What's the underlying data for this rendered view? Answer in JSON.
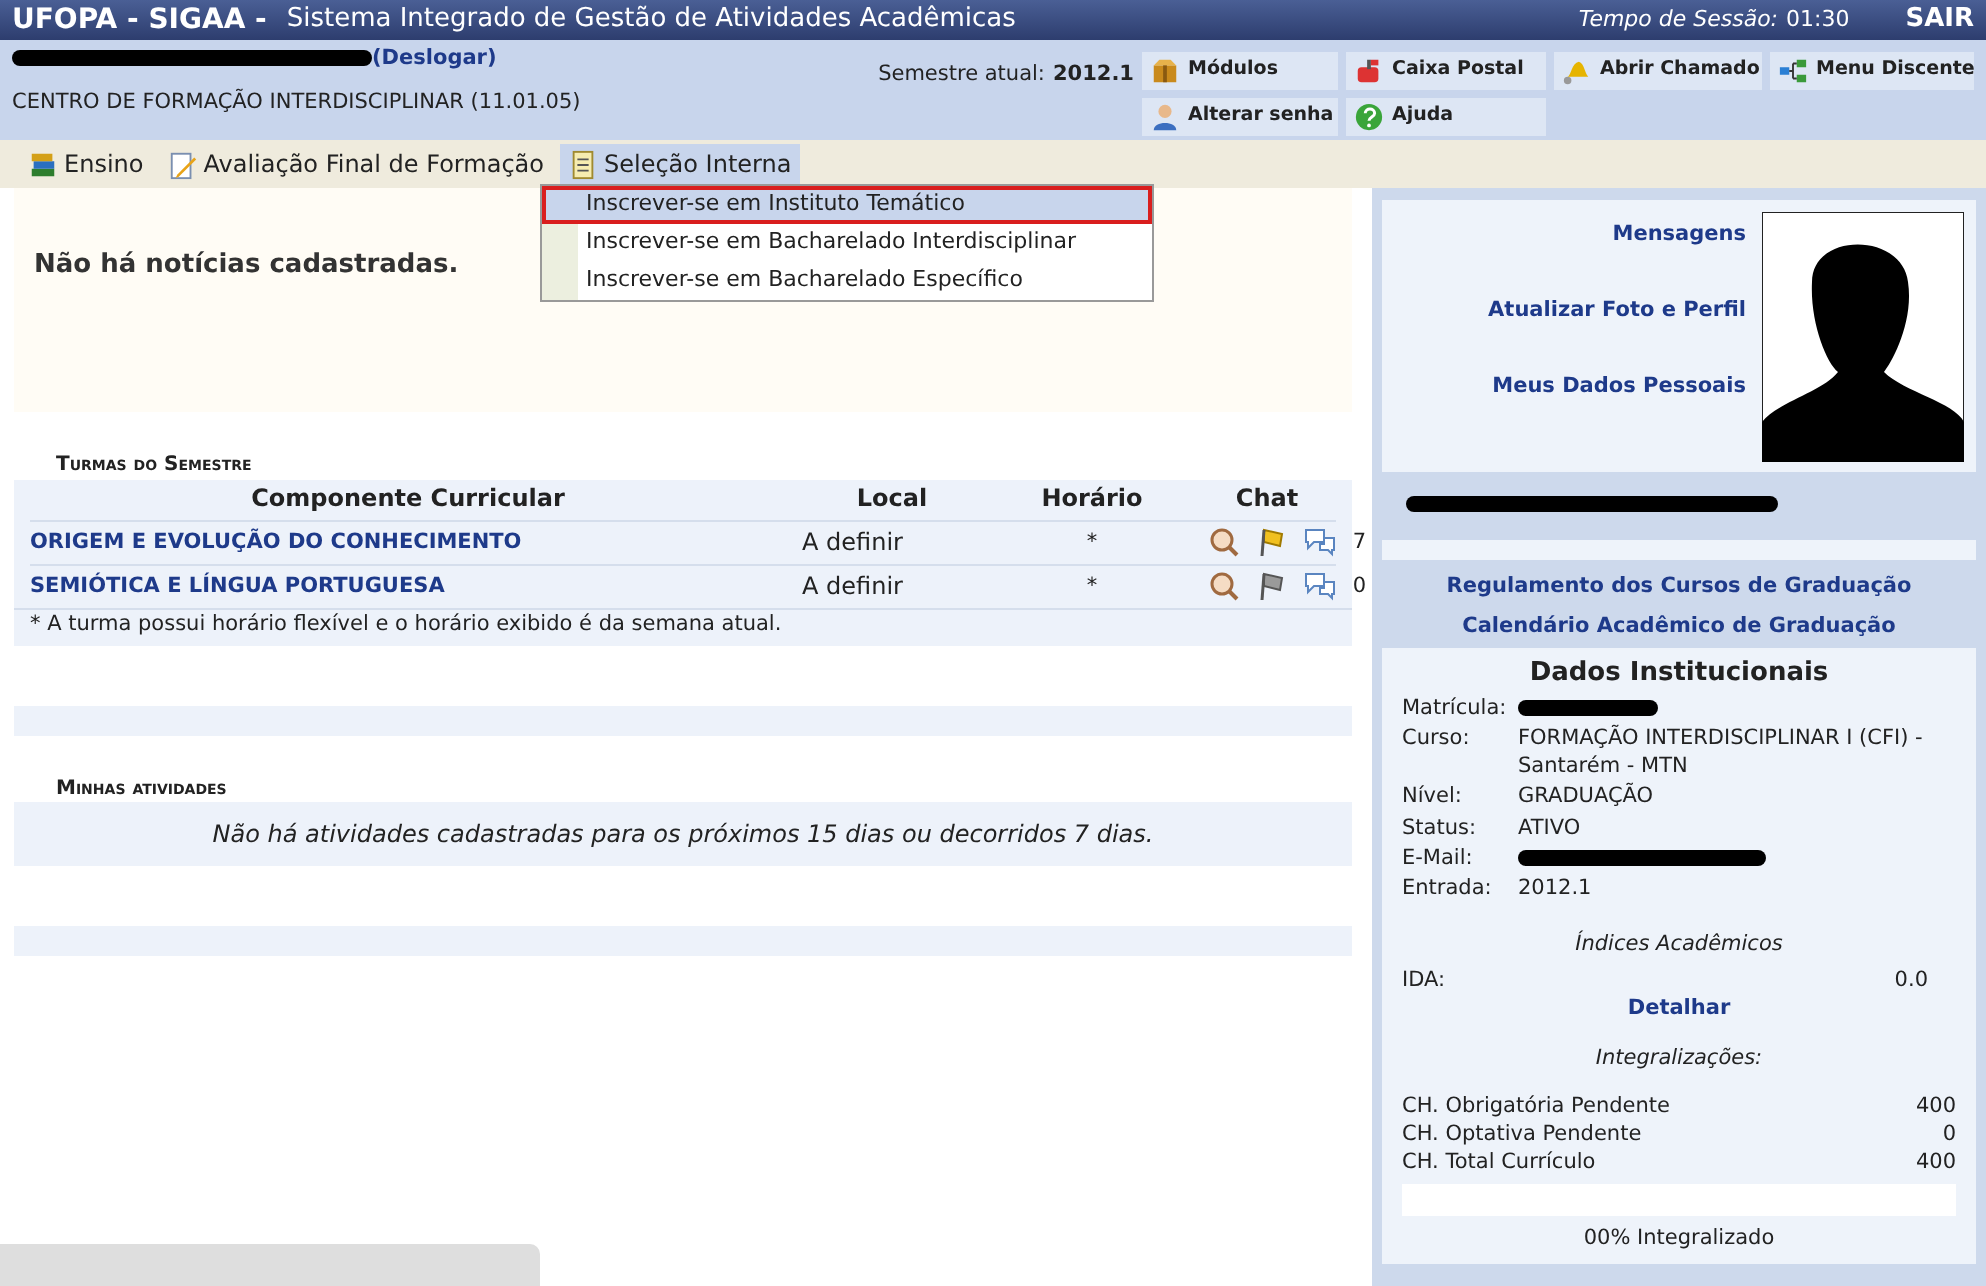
{
  "header": {
    "system": "UFOPA - SIGAA -",
    "title": "Sistema Integrado de Gestão de Atividades Acadêmicas",
    "session_label": "Tempo de Sessão:",
    "session_time": "01:30",
    "logout": "SAIR"
  },
  "user": {
    "logout_link": "(Deslogar)",
    "unit": "CENTRO DE FORMAÇÃO INTERDISCIPLINAR (11.01.05)",
    "semester_label": "Semestre atual:",
    "semester": "2012.1"
  },
  "shortcuts": [
    {
      "label": "Módulos",
      "kind": "box"
    },
    {
      "label": "Caixa Postal",
      "kind": "mailbox"
    },
    {
      "label": "Abrir Chamado",
      "kind": "bell"
    },
    {
      "label": "Menu Discente",
      "kind": "tree"
    },
    {
      "label": "Alterar senha",
      "kind": "person"
    },
    {
      "label": "Ajuda",
      "kind": "help"
    }
  ],
  "menu": [
    {
      "label": "Ensino",
      "kind": "books",
      "selected": false
    },
    {
      "label": "Avaliação Final de Formação",
      "kind": "pencil",
      "selected": false
    },
    {
      "label": "Seleção Interna",
      "kind": "document",
      "selected": true
    }
  ],
  "dropdown": [
    {
      "label": "Inscrever-se em Instituto Temático",
      "selected": true
    },
    {
      "label": "Inscrever-se em Bacharelado Interdisciplinar",
      "selected": false
    },
    {
      "label": "Inscrever-se em Bacharelado Específico",
      "selected": false
    }
  ],
  "news": "Não há notícias cadastradas.",
  "classes": {
    "heading": "Turmas do Semestre",
    "columns": [
      "Componente Curricular",
      "Local",
      "Horário",
      "Chat"
    ],
    "rows": [
      {
        "name": "ORIGEM E EVOLUÇÃO DO CONHECIMENTO",
        "local": "A definir",
        "schedule": "*",
        "forum_active": true,
        "chat_count": "7"
      },
      {
        "name": "SEMIÓTICA E LÍNGUA PORTUGUESA",
        "local": "A definir",
        "schedule": "*",
        "forum_active": false,
        "chat_count": "0"
      }
    ],
    "note": "* A turma possui horário flexível e o horário exibido é da semana atual."
  },
  "activities": {
    "heading": "Minhas atividades",
    "message": "Não há atividades cadastradas para os próximos 15 dias ou decorridos 7 dias."
  },
  "sidebar": {
    "links": [
      "Mensagens",
      "Atualizar Foto e Perfil",
      "Meus Dados Pessoais"
    ],
    "course_links": [
      "Regulamento dos Cursos de Graduação",
      "Calendário Acadêmico de Graduação"
    ],
    "institutional": {
      "title": "Dados Institucionais",
      "fields": [
        {
          "label": "Matrícula:",
          "redacted": true
        },
        {
          "label": "Curso:",
          "value": "FORMAÇÃO INTERDISCIPLINAR I (CFI) - Santarém - MTN",
          "redacted": false
        },
        {
          "label": "Nível:",
          "value": "GRADUAÇÃO",
          "redacted": false
        },
        {
          "label": "Status:",
          "value": "ATIVO",
          "redacted": false
        },
        {
          "label": "E-Mail:",
          "redacted": true
        },
        {
          "label": "Entrada:",
          "value": "2012.1",
          "redacted": false
        }
      ],
      "indices_title": "Índices Acadêmicos",
      "ida_label": "IDA:",
      "ida_value": "0.0",
      "detail_link": "Detalhar",
      "integ_title": "Integralizações:",
      "integ_rows": [
        {
          "label": "CH. Obrigatória Pendente",
          "value": "400"
        },
        {
          "label": "CH. Optativa Pendente",
          "value": "0"
        },
        {
          "label": "CH. Total Currículo",
          "value": "400"
        }
      ],
      "progress": {
        "level": 0,
        "label": "00% Integralizado"
      }
    }
  }
}
